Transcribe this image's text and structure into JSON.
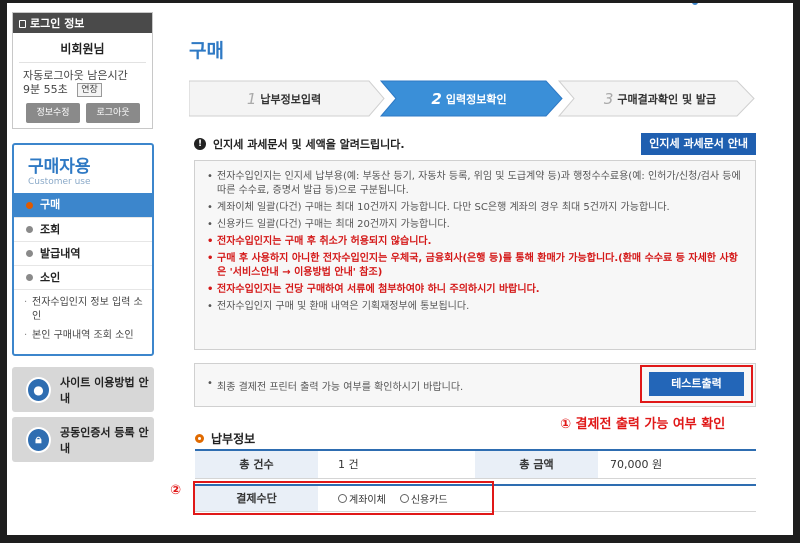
{
  "login": {
    "header": "로그인 정보",
    "user": "비회원님",
    "time_label": "자동로그아웃 남은시간",
    "time_value": "9분 55초",
    "extend": "연장",
    "edit": "정보수정",
    "logout": "로그아웃"
  },
  "menu": {
    "title": "구매자용",
    "subtitle": "Customer use",
    "items": [
      {
        "label": "구매"
      },
      {
        "label": "조회"
      },
      {
        "label": "발급내역"
      },
      {
        "label": "소인"
      }
    ],
    "subitems": [
      "전자수입인지 정보 입력 소인",
      "본인 구매내역 조회 소인"
    ]
  },
  "banners": {
    "site_guide": "사이트 이용방법 안내",
    "cert_register": "공동인증서 등록 안내"
  },
  "page": {
    "title": "구매"
  },
  "steps": [
    {
      "num": "1",
      "label": "납부정보입력"
    },
    {
      "num": "2",
      "label": "입력정보확인"
    },
    {
      "num": "3",
      "label": "구매결과확인 및 발급"
    }
  ],
  "notice": {
    "text": "인지세 과세문서 및 세액을 알려드립니다.",
    "button": "인지세 과세문서 안내"
  },
  "info_items": [
    {
      "text": "전자수입인지는 인지세 납부용(예: 부동산 등기, 자동차 등록, 위임 및 도급계약 등)과 행정수수료용(예: 인허가/신청/검사 등에 따른 수수료, 증명서 발급 등)으로 구분됩니다.",
      "red": false
    },
    {
      "text": "계좌이체 일괄(다건) 구매는 최대 10건까지 가능합니다. 다만 SC은행 계좌의 경우 최대 5건까지 가능합니다.",
      "red": false
    },
    {
      "text": "신용카드 일괄(다건) 구매는 최대 20건까지 가능합니다.",
      "red": false
    },
    {
      "text": "전자수입인지는 구매 후 취소가 허용되지 않습니다.",
      "red": true
    },
    {
      "text": "구매 후 사용하지 아니한 전자수입인지는 우체국, 금융회사(은행 등)를 통해 환매가 가능합니다.(환매 수수료 등 자세한 사항은 '서비스안내 → 이용방법 안내' 참조)",
      "red": true
    },
    {
      "text": "전자수입인지는 건당 구매하여 서류에 첨부하여야 하니 주의하시기 바랍니다.",
      "red": true
    },
    {
      "text": "전자수입인지 구매 및 환매 내역은 기획재정부에 통보됩니다.",
      "red": false
    }
  ],
  "test": {
    "message": "최종 결제전 프린터 출력 가능 여부를 확인하시기 바랍니다.",
    "button": "테스트출력"
  },
  "annotations": {
    "one": "① 결제전 출력 가능 여부 확인",
    "two": "②"
  },
  "payment": {
    "section_title": "납부정보",
    "total_count_label": "총 건수",
    "total_count_value": "1 건",
    "total_amount_label": "총 금액",
    "total_amount_value": "70,000 원",
    "method_label": "결제수단",
    "options": [
      "계좌이체",
      "신용카드"
    ]
  },
  "colors": {
    "accent": "#2e79c4",
    "button": "#2366b8",
    "alert": "#e01818"
  }
}
